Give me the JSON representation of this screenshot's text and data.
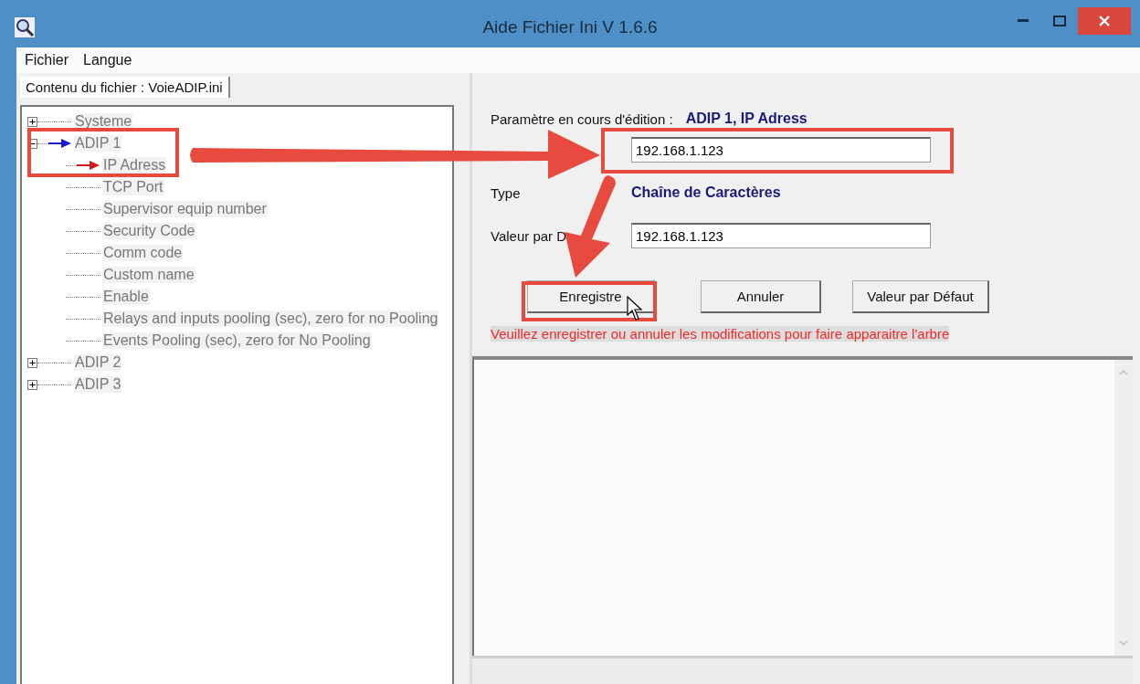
{
  "window": {
    "title": "Aide Fichier Ini V 1.6.6"
  },
  "menu": [
    "Fichier",
    "Langue"
  ],
  "tabs": [
    {
      "label": "Contenu du fichier : VoieADIP.ini",
      "selected": true
    }
  ],
  "tree": [
    {
      "label": "Systeme",
      "expanded": false,
      "selected": false
    },
    {
      "label": "ADIP 1",
      "expanded": true,
      "selected": false,
      "children": [
        {
          "label": "IP Adress",
          "selected": true
        },
        {
          "label": "TCP Port",
          "selected": false
        },
        {
          "label": "Supervisor equip number",
          "selected": false
        },
        {
          "label": "Security Code",
          "selected": false
        },
        {
          "label": "Comm code",
          "selected": false
        },
        {
          "label": "Custom name",
          "selected": false
        },
        {
          "label": "Enable",
          "selected": false
        },
        {
          "label": "Relays and inputs pooling (sec), zero for no Pooling",
          "selected": false
        },
        {
          "label": "Events Pooling (sec), zero for No Pooling",
          "selected": false
        }
      ]
    },
    {
      "label": "ADIP 2",
      "expanded": false,
      "selected": false
    },
    {
      "label": "ADIP 3",
      "expanded": false,
      "selected": false
    }
  ],
  "editor": {
    "param_label": "Paramètre en cours d'édition :",
    "param_value": "ADIP 1, IP Adress",
    "value": "192.168.1.123",
    "type_label": "Type",
    "type_value": "Chaîne de Caractères",
    "default_label": "Valeur par D",
    "default_value": "192.168.1.123"
  },
  "buttons": [
    "Enregistre",
    "Annuler",
    "Valeur par Défaut"
  ],
  "warning": "Veuillez enregistrer ou annuler les modifications pour faire apparaitre l'arbre"
}
